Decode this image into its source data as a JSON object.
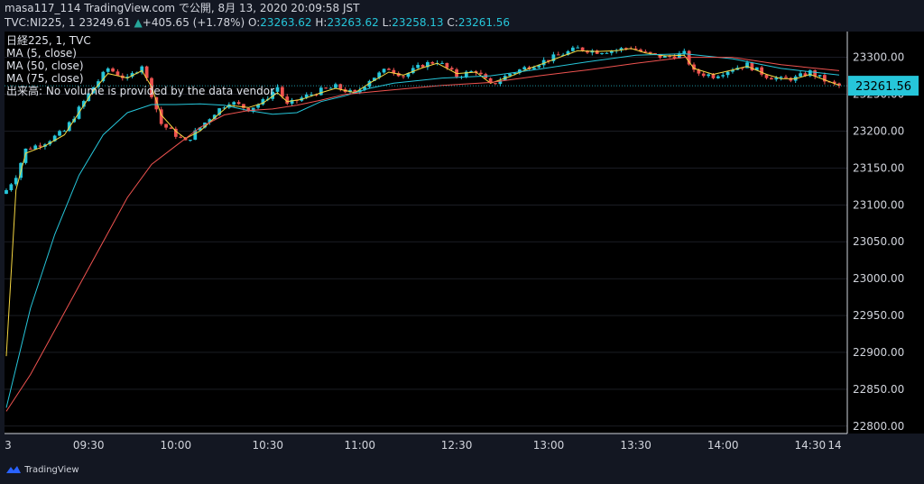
{
  "header": {
    "line1": "masa117_114 TradingView.com で公開, 8月 13, 2020 20:09:58 JST",
    "line2_prefix": "TVC:NI225, 1  23249.61",
    "line2_change": "+405.65 (+1.78%)",
    "o_label": "O:",
    "o_value": "23263.62",
    "h_label": "H:",
    "h_value": "23263.62",
    "l_label": "L:",
    "l_value": "23258.13",
    "c_label": "C:",
    "c_value": "23261.56"
  },
  "legend": {
    "title": "日経225, 1, TVC",
    "ma5": "MA (5, close)",
    "ma50": "MA (50, close)",
    "ma75": "MA (75, close)",
    "volume": "出来高: No volume is provided by the data vendor."
  },
  "footer": {
    "brand": "TradingView"
  },
  "colors": {
    "up": "#26c6da",
    "down": "#ef5350",
    "ma5": "#f5d742",
    "ma50": "#26c6da",
    "ma75": "#ef5350",
    "price_tag": "#26c6da",
    "grid": "#2a2e39"
  },
  "chart_data": {
    "type": "candlestick",
    "title": "日経225, 1, TVC",
    "xlabel": "",
    "ylabel": "",
    "x_ticks": [
      "3",
      "09:30",
      "10:00",
      "10:30",
      "11:00",
      "12:30",
      "13:00",
      "13:30",
      "14:00",
      "14:30",
      "14"
    ],
    "y_ticks": [
      "22800.00",
      "22850.00",
      "22900.00",
      "22950.00",
      "23000.00",
      "23050.00",
      "23100.00",
      "23150.00",
      "23200.00",
      "23250.00",
      "23300.00"
    ],
    "ylim": [
      22790,
      23335
    ],
    "last_price": "23261.56",
    "close_path": [
      [
        0,
        23120
      ],
      [
        2,
        23140
      ],
      [
        4,
        23175
      ],
      [
        8,
        23185
      ],
      [
        12,
        23200
      ],
      [
        15,
        23230
      ],
      [
        18,
        23260
      ],
      [
        21,
        23285
      ],
      [
        25,
        23270
      ],
      [
        28,
        23290
      ],
      [
        30,
        23250
      ],
      [
        32,
        23210
      ],
      [
        35,
        23195
      ],
      [
        37,
        23185
      ],
      [
        40,
        23205
      ],
      [
        43,
        23225
      ],
      [
        46,
        23240
      ],
      [
        50,
        23230
      ],
      [
        53,
        23240
      ],
      [
        56,
        23260
      ],
      [
        58,
        23235
      ],
      [
        61,
        23245
      ],
      [
        65,
        23255
      ],
      [
        68,
        23260
      ],
      [
        72,
        23250
      ],
      [
        75,
        23270
      ],
      [
        79,
        23285
      ],
      [
        82,
        23275
      ],
      [
        86,
        23290
      ],
      [
        89,
        23295
      ],
      [
        93,
        23275
      ],
      [
        97,
        23282
      ],
      [
        100,
        23262
      ],
      [
        104,
        23278
      ],
      [
        108,
        23288
      ],
      [
        111,
        23295
      ],
      [
        115,
        23305
      ],
      [
        118,
        23312
      ],
      [
        122,
        23308
      ],
      [
        126,
        23310
      ],
      [
        129,
        23314
      ],
      [
        132,
        23305
      ],
      [
        136,
        23300
      ],
      [
        140,
        23305
      ],
      [
        142,
        23280
      ],
      [
        146,
        23275
      ],
      [
        150,
        23285
      ],
      [
        153,
        23290
      ],
      [
        157,
        23275
      ],
      [
        160,
        23270
      ],
      [
        163,
        23272
      ],
      [
        166,
        23280
      ],
      [
        170,
        23265
      ],
      [
        172,
        23261
      ]
    ],
    "series": [
      {
        "name": "MA (5, close)",
        "values": [
          [
            0,
            22895
          ],
          [
            2,
            23120
          ],
          [
            4,
            23170
          ],
          [
            8,
            23180
          ],
          [
            12,
            23195
          ],
          [
            15,
            23225
          ],
          [
            18,
            23255
          ],
          [
            21,
            23278
          ],
          [
            25,
            23272
          ],
          [
            28,
            23282
          ],
          [
            30,
            23260
          ],
          [
            32,
            23222
          ],
          [
            35,
            23200
          ],
          [
            37,
            23190
          ],
          [
            40,
            23200
          ],
          [
            43,
            23218
          ],
          [
            46,
            23235
          ],
          [
            50,
            23232
          ],
          [
            53,
            23238
          ],
          [
            56,
            23252
          ],
          [
            58,
            23240
          ],
          [
            61,
            23243
          ],
          [
            65,
            23252
          ],
          [
            68,
            23258
          ],
          [
            72,
            23252
          ],
          [
            75,
            23265
          ],
          [
            79,
            23280
          ],
          [
            82,
            23276
          ],
          [
            86,
            23286
          ],
          [
            89,
            23292
          ],
          [
            93,
            23278
          ],
          [
            97,
            23280
          ],
          [
            100,
            23265
          ],
          [
            104,
            23274
          ],
          [
            108,
            23285
          ],
          [
            111,
            23292
          ],
          [
            115,
            23302
          ],
          [
            118,
            23309
          ],
          [
            122,
            23308
          ],
          [
            126,
            23309
          ],
          [
            129,
            23312
          ],
          [
            132,
            23306
          ],
          [
            136,
            23302
          ],
          [
            140,
            23303
          ],
          [
            142,
            23285
          ],
          [
            146,
            23277
          ],
          [
            150,
            23283
          ],
          [
            153,
            23288
          ],
          [
            157,
            23277
          ],
          [
            160,
            23271
          ],
          [
            163,
            23271
          ],
          [
            166,
            23277
          ],
          [
            170,
            23267
          ],
          [
            172,
            23262
          ]
        ]
      },
      {
        "name": "MA (50, close)",
        "values": [
          [
            0,
            22825
          ],
          [
            5,
            22960
          ],
          [
            10,
            23060
          ],
          [
            15,
            23140
          ],
          [
            20,
            23195
          ],
          [
            25,
            23225
          ],
          [
            30,
            23236
          ],
          [
            35,
            23236
          ],
          [
            40,
            23237
          ],
          [
            45,
            23235
          ],
          [
            50,
            23228
          ],
          [
            55,
            23223
          ],
          [
            60,
            23225
          ],
          [
            65,
            23240
          ],
          [
            70,
            23248
          ],
          [
            75,
            23258
          ],
          [
            80,
            23265
          ],
          [
            90,
            23272
          ],
          [
            100,
            23275
          ],
          [
            110,
            23284
          ],
          [
            120,
            23294
          ],
          [
            130,
            23303
          ],
          [
            140,
            23305
          ],
          [
            150,
            23298
          ],
          [
            160,
            23285
          ],
          [
            172,
            23276
          ]
        ]
      },
      {
        "name": "MA (75, close)",
        "values": [
          [
            0,
            22820
          ],
          [
            5,
            22870
          ],
          [
            10,
            22930
          ],
          [
            15,
            22990
          ],
          [
            20,
            23050
          ],
          [
            25,
            23110
          ],
          [
            30,
            23155
          ],
          [
            35,
            23180
          ],
          [
            40,
            23205
          ],
          [
            45,
            23222
          ],
          [
            50,
            23228
          ],
          [
            55,
            23230
          ],
          [
            60,
            23235
          ],
          [
            65,
            23242
          ],
          [
            70,
            23250
          ],
          [
            80,
            23256
          ],
          [
            90,
            23262
          ],
          [
            100,
            23266
          ],
          [
            110,
            23275
          ],
          [
            120,
            23283
          ],
          [
            130,
            23292
          ],
          [
            140,
            23300
          ],
          [
            150,
            23300
          ],
          [
            160,
            23290
          ],
          [
            172,
            23282
          ]
        ]
      }
    ]
  }
}
